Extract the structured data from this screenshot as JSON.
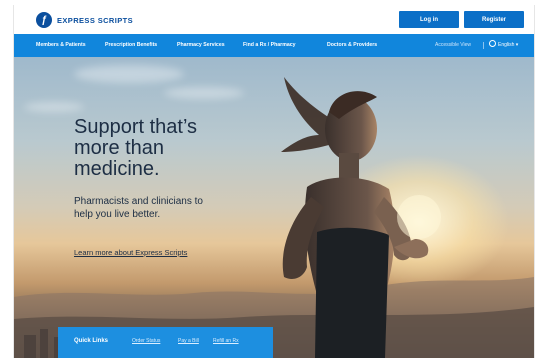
{
  "header": {
    "logo_text": "EXPRESS SCRIPTS",
    "login_label": "Log in",
    "register_label": "Register"
  },
  "nav": {
    "items": [
      "Members & Patients",
      "Prescription Benefits",
      "Pharmacy Services",
      "Find a Rx / Pharmacy",
      "Doctors & Providers"
    ],
    "accessible_view": "Accessible View",
    "language": "English"
  },
  "hero": {
    "title_lines": [
      "Support that’s",
      "more than",
      "medicine."
    ],
    "subtitle_lines": [
      "Pharmacists and clinicians to",
      "help you live better."
    ],
    "link": "Learn more about Express Scripts"
  },
  "quick_links": {
    "title": "Quick Links",
    "links": [
      "Order Status",
      "Pay a Bill",
      "Refill an Rx"
    ]
  },
  "colors": {
    "brand": "#0b4f9e",
    "nav": "#1186dc",
    "button": "#0b6fc7",
    "quick_links": "#1d8fe0"
  }
}
